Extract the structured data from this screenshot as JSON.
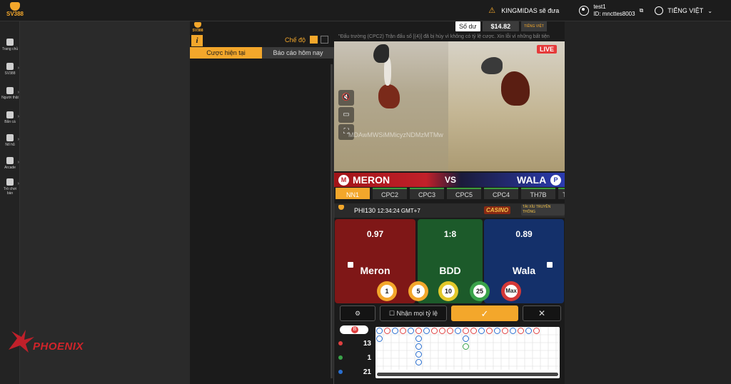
{
  "brand": {
    "logo_text": "SV388"
  },
  "header": {
    "notice": "KINGMIDAS sẽ đưa",
    "username": "test1",
    "user_id": "ID: mncttes8003",
    "language": "TIẾNG VIỆT"
  },
  "sidebar": {
    "items": [
      {
        "label": "Trang chủ",
        "icon": "home-icon"
      },
      {
        "label": "SV388",
        "icon": "rooster-icon"
      },
      {
        "label": "Người thật",
        "icon": "cards-icon"
      },
      {
        "label": "Bắn cá",
        "icon": "fish-icon"
      },
      {
        "label": "Nổ hũ",
        "icon": "slot-icon"
      },
      {
        "label": "Arcade",
        "icon": "arcade-icon"
      },
      {
        "label": "Trò chơi bàn",
        "icon": "table-game-icon"
      }
    ]
  },
  "sponsor": {
    "name": "PHOENIX"
  },
  "left_panel": {
    "badge_text": "SV388",
    "mode_label": "Chế độ",
    "tabs": [
      {
        "label": "Cược hiện tại",
        "active": true
      },
      {
        "label": "Báo cáo hôm nay",
        "active": false
      }
    ]
  },
  "game": {
    "balance_label": "Số dư",
    "balance_value": "$14.82",
    "language_mini": "TIẾNG VIỆT",
    "ticker": "\"Đấu trường (CPC2) Trận đấu số [(4)] đã bị hủy vì không có tỷ lệ cược. Xin lỗi vì những bất tiện",
    "live_badge": "LIVE",
    "watermark": "MDAwMWSiMMicyzNDMzMTMw",
    "meron_label": "MERON",
    "vs_label": "VS",
    "wala_label": "WALA",
    "tables": [
      "NN1",
      "CPC2",
      "CPC3",
      "CPC5",
      "CPC4",
      "TH7B",
      "T"
    ],
    "active_table": "NN1",
    "match_info": "PHI130",
    "match_time": "12:34:24 GMT+7",
    "casino_label": "CASINO",
    "taixiu_label": "TÀI XỈU TRUYỀN THỐNG",
    "bets": [
      {
        "name": "Meron",
        "odds": "0.97",
        "color": "#8c1a1a"
      },
      {
        "name": "BDD",
        "odds": "1:8",
        "color": "#1d5a2a"
      },
      {
        "name": "Wala",
        "odds": "0.89",
        "color": "#15306a"
      }
    ],
    "chips": [
      "1",
      "5",
      "10",
      "25",
      "Max"
    ],
    "actions": {
      "accept_odds_label": "Nhận mọi tỷ lệ",
      "confirm_icon": "✓",
      "cancel_icon": "✕"
    },
    "stats": [
      {
        "label": "B",
        "color": "#e04040"
      },
      {
        "count": "13",
        "color": "#e04040"
      },
      {
        "count": "1",
        "color": "#3aa34a"
      },
      {
        "count": "21",
        "color": "#2a6fd0"
      }
    ]
  }
}
